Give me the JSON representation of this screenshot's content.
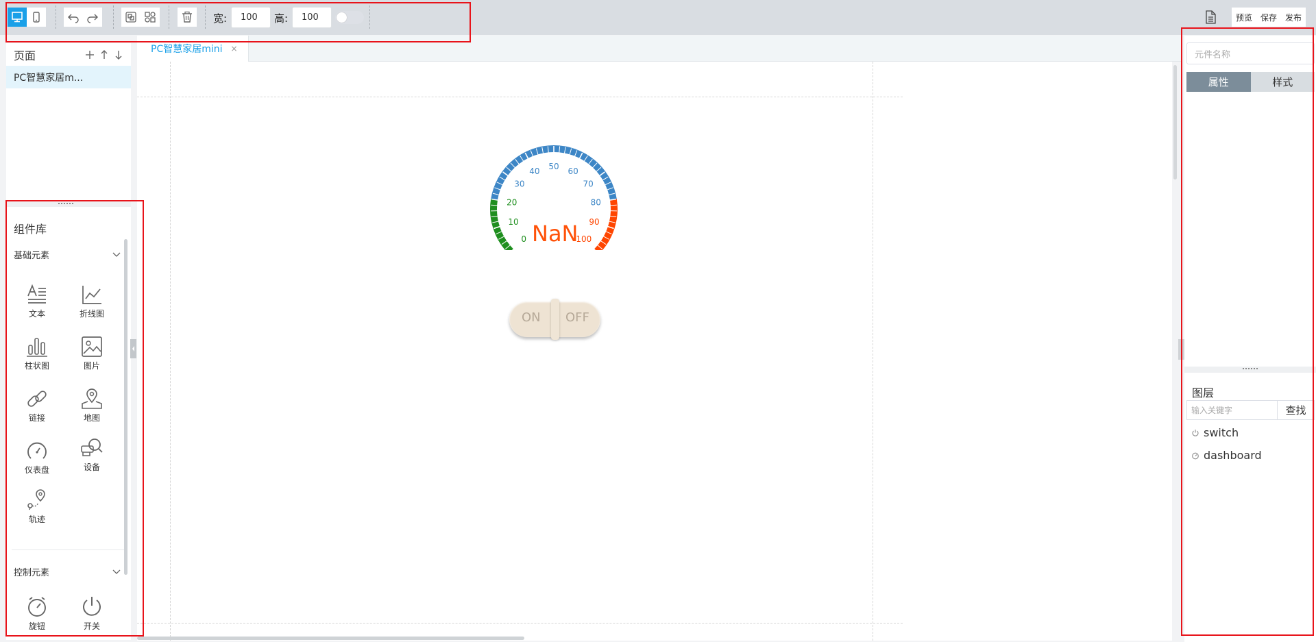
{
  "toolbar": {
    "width_label": "宽:",
    "width_value": "100",
    "height_label": "高:",
    "height_value": "100",
    "preview": "预览",
    "save": "保存",
    "publish": "发布",
    "icons": [
      "desktop-icon",
      "mobile-icon",
      "undo-icon",
      "redo-icon",
      "copy-icon",
      "group-icon",
      "trash-icon",
      "document-icon"
    ]
  },
  "pages": {
    "title": "页面",
    "items": [
      "PC智慧家居m..."
    ]
  },
  "library": {
    "title": "组件库",
    "basic": {
      "label": "基础元素",
      "items": [
        {
          "label": "文本",
          "icon": "text-icon"
        },
        {
          "label": "折线图",
          "icon": "line-chart-icon"
        },
        {
          "label": "柱状图",
          "icon": "bar-chart-icon"
        },
        {
          "label": "图片",
          "icon": "image-icon"
        },
        {
          "label": "链接",
          "icon": "link-icon"
        },
        {
          "label": "地图",
          "icon": "map-icon"
        },
        {
          "label": "仪表盘",
          "icon": "gauge-icon"
        },
        {
          "label": "设备",
          "icon": "device-icon"
        },
        {
          "label": "轨迹",
          "icon": "track-icon"
        }
      ]
    },
    "control": {
      "label": "控制元素",
      "items": [
        {
          "label": "旋钮",
          "icon": "knob-icon"
        },
        {
          "label": "开关",
          "icon": "power-icon"
        }
      ]
    }
  },
  "tab": {
    "label": "PC智慧家居mini",
    "close": "×"
  },
  "gauge": {
    "value": "NaN",
    "ticks": [
      "0",
      "10",
      "20",
      "30",
      "40",
      "50",
      "60",
      "70",
      "80",
      "90",
      "100"
    ],
    "colors": {
      "low": "#1f8f1f",
      "mid": "#3d86c6",
      "high": "#ff4500"
    }
  },
  "switch": {
    "on": "ON",
    "off": "OFF"
  },
  "right": {
    "name_placeholder": "元件名称",
    "tab_props": "属性",
    "tab_style": "样式",
    "layers_title": "图层",
    "layer_search_placeholder": "输入关键字",
    "layer_search_button": "查找",
    "layers": [
      {
        "label": "switch",
        "icon": "power-icon"
      },
      {
        "label": "dashboard",
        "icon": "gauge-icon"
      }
    ]
  },
  "colors": {
    "accent": "#1aa0e8",
    "annotation": "#e8131a"
  }
}
